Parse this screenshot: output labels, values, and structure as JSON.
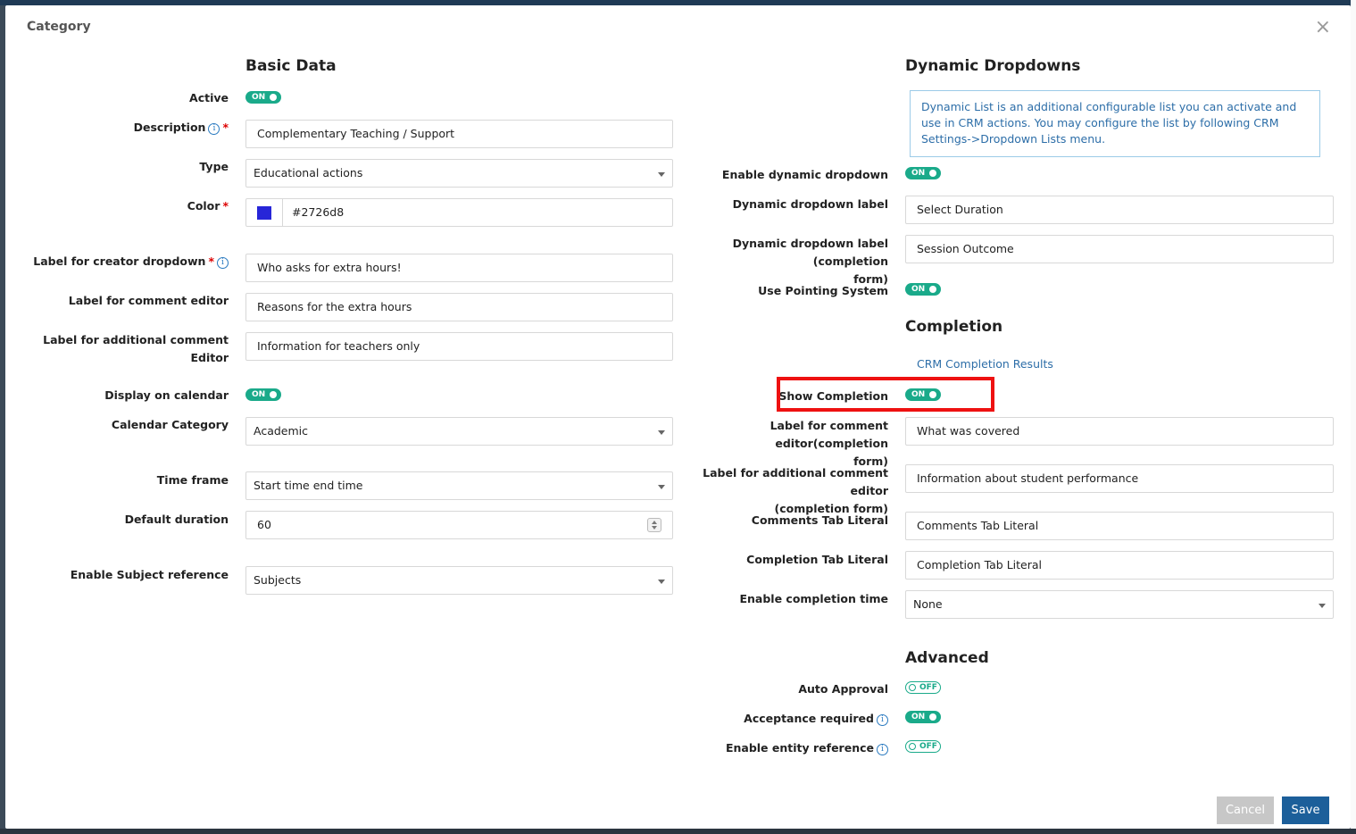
{
  "modal": {
    "title": "Category",
    "close": "×"
  },
  "basic": {
    "section_title": "Basic Data",
    "active_label": "Active",
    "active_state": "ON",
    "description_label": "Description",
    "description_value": "Complementary Teaching / Support",
    "type_label": "Type",
    "type_value": "Educational actions",
    "color_label": "Color",
    "color_value": "#2726d8",
    "creator_dropdown_label": "Label for creator dropdown",
    "creator_dropdown_value": "Who asks for extra hours!",
    "comment_editor_label": "Label for comment editor",
    "comment_editor_value": "Reasons for the extra hours",
    "additional_comment_label": "Label for additional comment Editor",
    "additional_comment_value": "Information for teachers only",
    "display_calendar_label": "Display on calendar",
    "display_calendar_state": "ON",
    "calendar_category_label": "Calendar Category",
    "calendar_category_value": "Academic",
    "time_frame_label": "Time frame",
    "time_frame_value": "Start time end time",
    "default_duration_label": "Default duration",
    "default_duration_value": "60",
    "subject_ref_label": "Enable Subject reference",
    "subject_ref_value": "Subjects"
  },
  "dynamic": {
    "section_title": "Dynamic Dropdowns",
    "info_text": "Dynamic List is an additional configurable list you can activate and use in CRM actions. You may configure the list by following CRM Settings->Dropdown Lists menu.",
    "enable_label": "Enable dynamic dropdown",
    "enable_state": "ON",
    "dropdown_label_label": "Dynamic dropdown label",
    "dropdown_label_value": "Select Duration",
    "dropdown_completion_label_1": "Dynamic dropdown label (completion",
    "dropdown_completion_label_2": "form)",
    "dropdown_completion_value": "Session Outcome",
    "pointing_label": "Use Pointing System",
    "pointing_state": "ON"
  },
  "completion": {
    "section_title": "Completion",
    "results_link": "CRM Completion Results",
    "show_label": "Show Completion",
    "show_state": "ON",
    "comment_editor_label_1": "Label for comment editor(completion",
    "comment_editor_label_2": "form)",
    "comment_editor_value": "What was covered",
    "additional_label_1": "Label for additional comment editor",
    "additional_label_2": "(completion form)",
    "additional_value": "Information about student performance",
    "comments_tab_label": "Comments Tab Literal",
    "comments_tab_value": "Comments Tab Literal",
    "completion_tab_label": "Completion Tab Literal",
    "completion_tab_value": "Completion Tab Literal",
    "completion_time_label": "Enable completion time",
    "completion_time_value": "None"
  },
  "advanced": {
    "section_title": "Advanced",
    "auto_approval_label": "Auto Approval",
    "auto_approval_state": "OFF",
    "acceptance_label": "Acceptance required",
    "acceptance_state": "ON",
    "entity_ref_label": "Enable entity reference",
    "entity_ref_state": "OFF"
  },
  "footer": {
    "cancel": "Cancel",
    "save": "Save"
  },
  "colors": {
    "toggle_on": "#1aaa8a",
    "save_button": "#1c5f9a",
    "highlight": "#ee1111",
    "swatch": "#2726d8"
  }
}
